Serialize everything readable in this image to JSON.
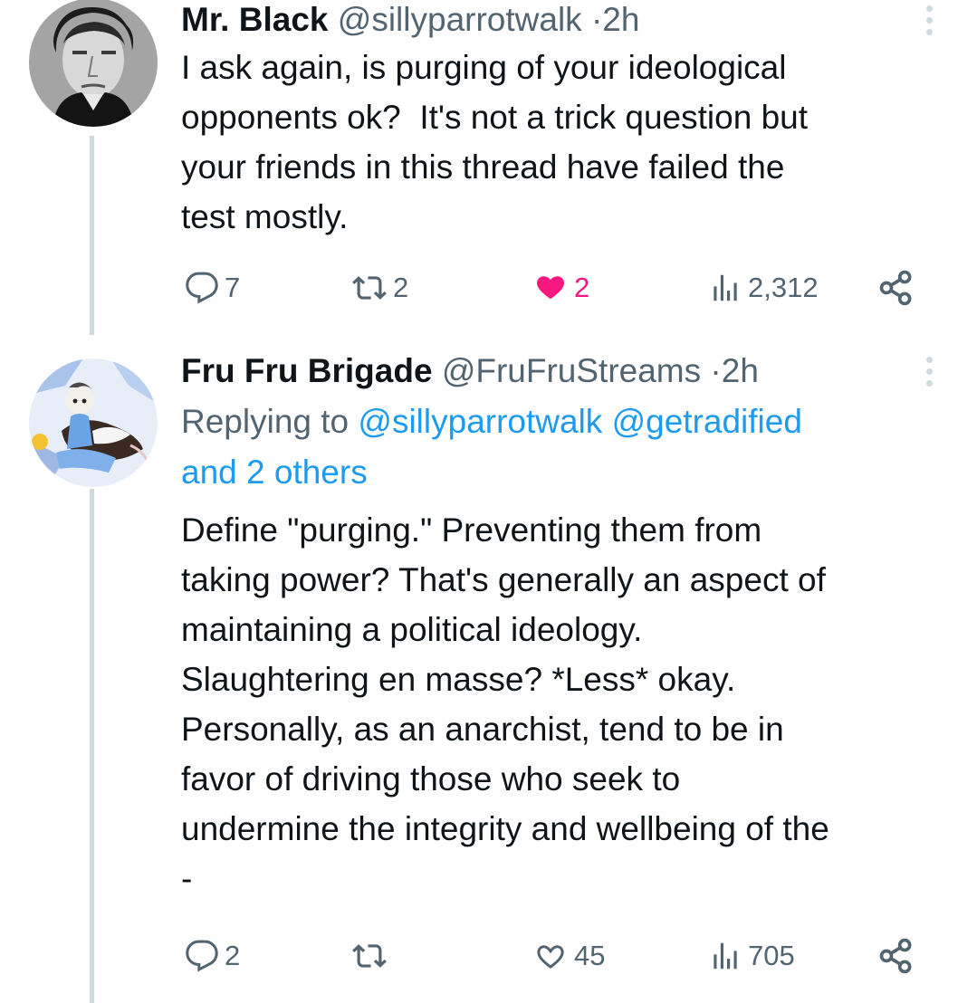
{
  "tweets": [
    {
      "name": "Mr. Black",
      "handle": "@sillyparrotwalk",
      "time": "2h",
      "body": "I ask again, is purging of your ideological\nopponents ok?  It's not a trick question but\nyour friends in this thread have failed the\ntest mostly.",
      "replies": "7",
      "reposts": "2",
      "likes": "2",
      "views": "2,312",
      "liked": true,
      "avatar_icon": "avatar-icon"
    },
    {
      "name": "Fru Fru Brigade",
      "handle": "@FruFruStreams",
      "time": "2h",
      "replying_prefix": "Replying to",
      "replying_mention_1": "@sillyparrotwalk",
      "replying_mention_2": "@getradified",
      "replying_rest": "and 2 others",
      "body": "Define \"purging.\" Preventing them from\ntaking power? That's generally an aspect of\nmaintaining a political ideology.\nSlaughtering en masse? *Less* okay.\nPersonally, as an anarchist, tend to be in\nfavor of driving those who seek to\nundermine the integrity and wellbeing of the\n-",
      "replies": "2",
      "reposts": "",
      "likes": "45",
      "views": "705",
      "liked": false,
      "avatar_icon": "avatar-icon"
    }
  ],
  "colors": {
    "text": "#0f1419",
    "muted": "#536471",
    "link": "#1d9bf0",
    "like": "#f91880",
    "thread_line": "#cfd9de"
  },
  "icons": [
    "reply-icon",
    "repost-icon",
    "like-icon",
    "views-icon",
    "share-icon",
    "more-options-icon"
  ]
}
